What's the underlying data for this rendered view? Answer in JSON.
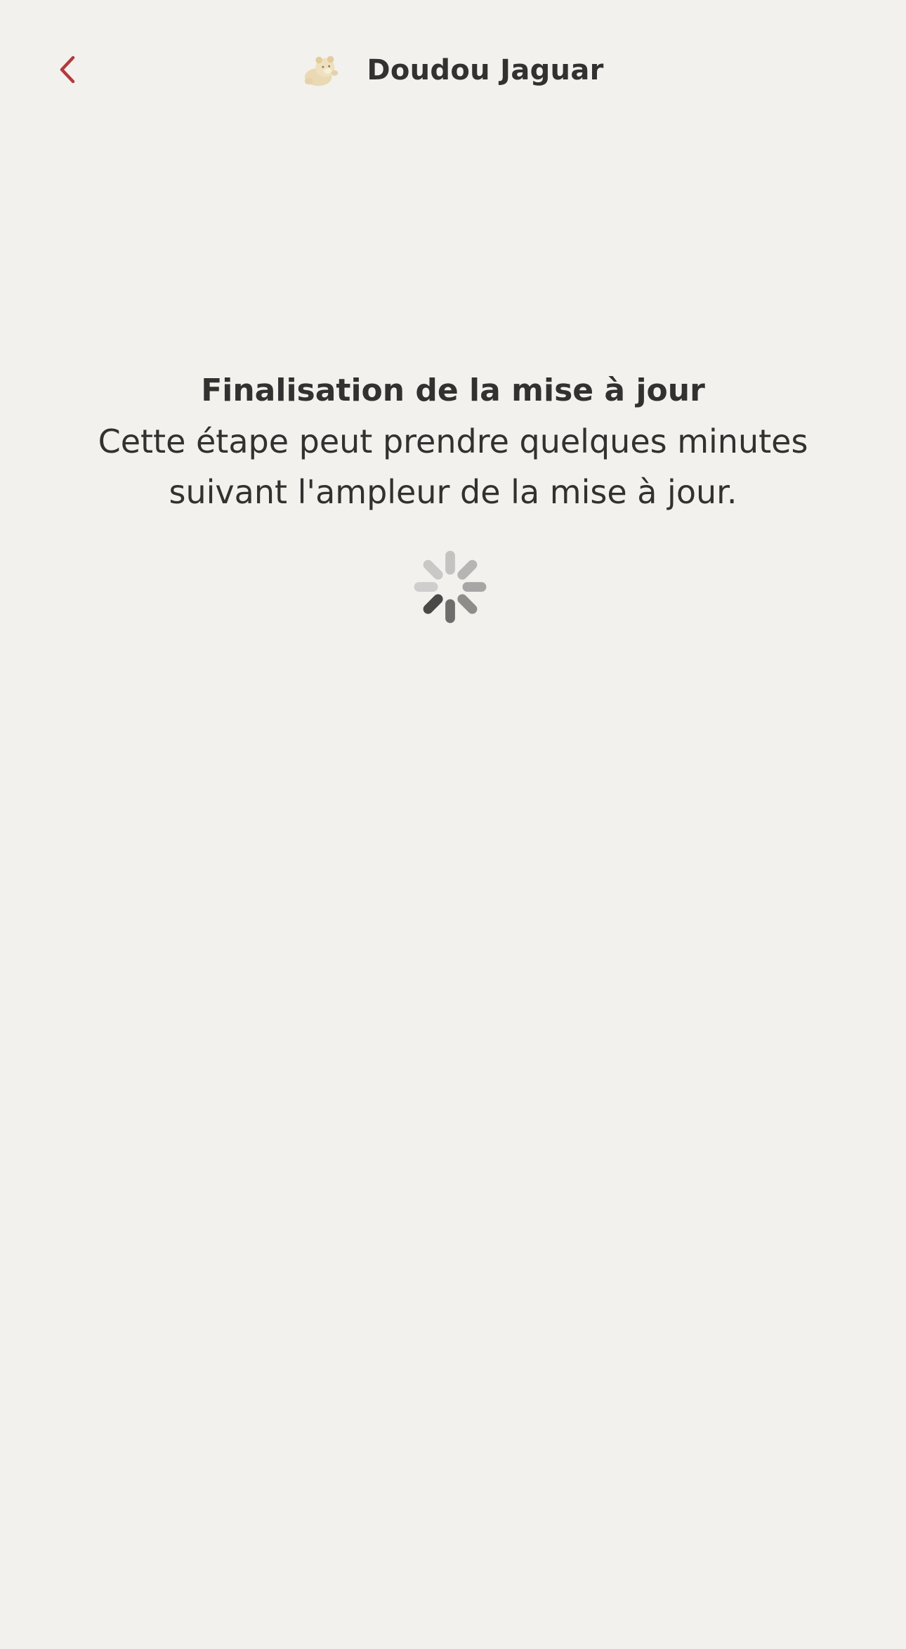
{
  "header": {
    "back_icon": "chevron-left-icon",
    "avatar_icon": "plush-toy-icon",
    "title": "Doudou Jaguar"
  },
  "message": {
    "title": "Finalisation de la mise à jour",
    "body": "Cette étape peut prendre quelques minutes suivant l'ampleur de la mise à jour."
  },
  "spinner": {
    "icon": "loading-spinner-icon"
  },
  "colors": {
    "background": "#f2f1ee",
    "text": "#333130",
    "accent": "#b23a3a"
  }
}
